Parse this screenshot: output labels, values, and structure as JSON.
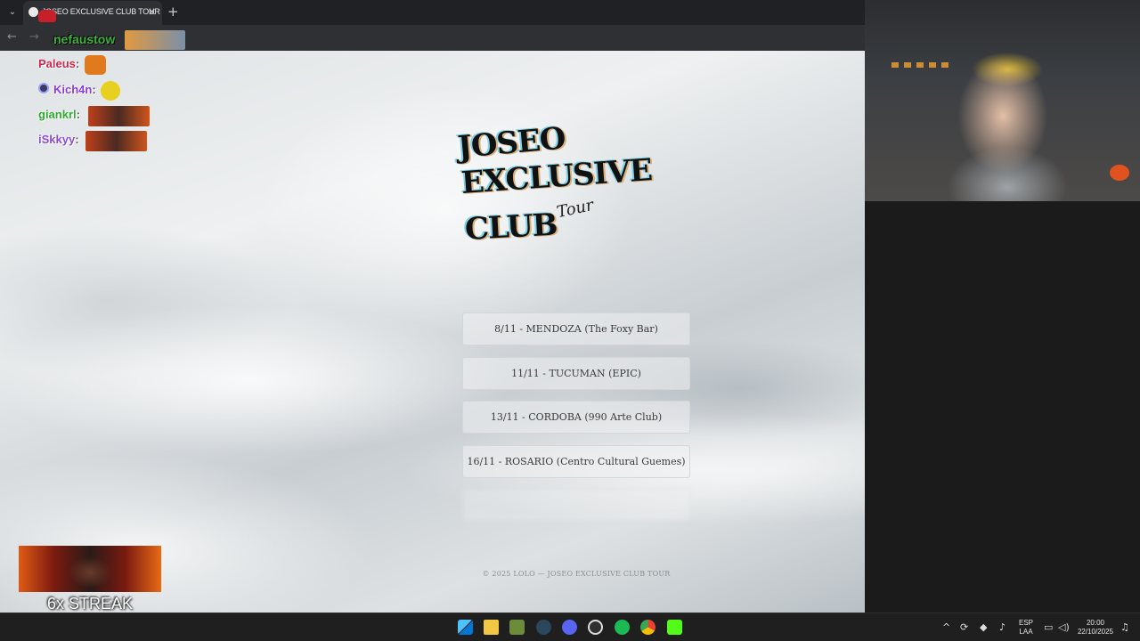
{
  "browser": {
    "tab_title": "JOSEO EXCLUSIVE CLUB TOUR",
    "tab_close": "✕",
    "new_tab": "+",
    "tab_list": "⌄",
    "back": "←",
    "forward": "→"
  },
  "site": {
    "logo": {
      "line1": "JOSEO",
      "line2": "EXCLUSIVE",
      "line3": "CLUB",
      "script": "Tour"
    },
    "dates": [
      {
        "label": "8/11 - MENDOZA (The Foxy Bar)"
      },
      {
        "label": "11/11 - TUCUMAN (EPIC)"
      },
      {
        "label": "13/11 - CORDOBA (990 Arte Club)"
      },
      {
        "label": "16/11 - ROSARIO (Centro Cultural Guemes)"
      },
      {
        "label": ""
      }
    ],
    "footer": "© 2025 LOLO — JOSEO EXCLUSIVE CLUB TOUR"
  },
  "chat": {
    "messages": [
      {
        "user": "nefaustow"
      },
      {
        "user": "Paleus",
        "sep": ":"
      },
      {
        "user": "Kich4n",
        "sep": ":"
      },
      {
        "user": "giankrl",
        "sep": ":"
      },
      {
        "user": "iSkkyy",
        "sep": ":"
      }
    ]
  },
  "overlay": {
    "streak": "6x STREAK"
  },
  "taskbar": {
    "lang_top": "ESP",
    "lang_bottom": "LAA",
    "time": "20:00",
    "date": "22/10/2025",
    "icons": [
      "windows-start-icon",
      "file-explorer-icon",
      "game-launcher-icon",
      "steam-icon",
      "discord-icon",
      "obs-icon",
      "spotify-icon",
      "chrome-icon",
      "kick-icon"
    ]
  },
  "colors": {
    "chat_green": "#3fb53f",
    "chat_red": "#d4234a",
    "chat_purple": "#8a3bd6",
    "kick_green": "#53fc18",
    "spotify_green": "#1db954"
  }
}
